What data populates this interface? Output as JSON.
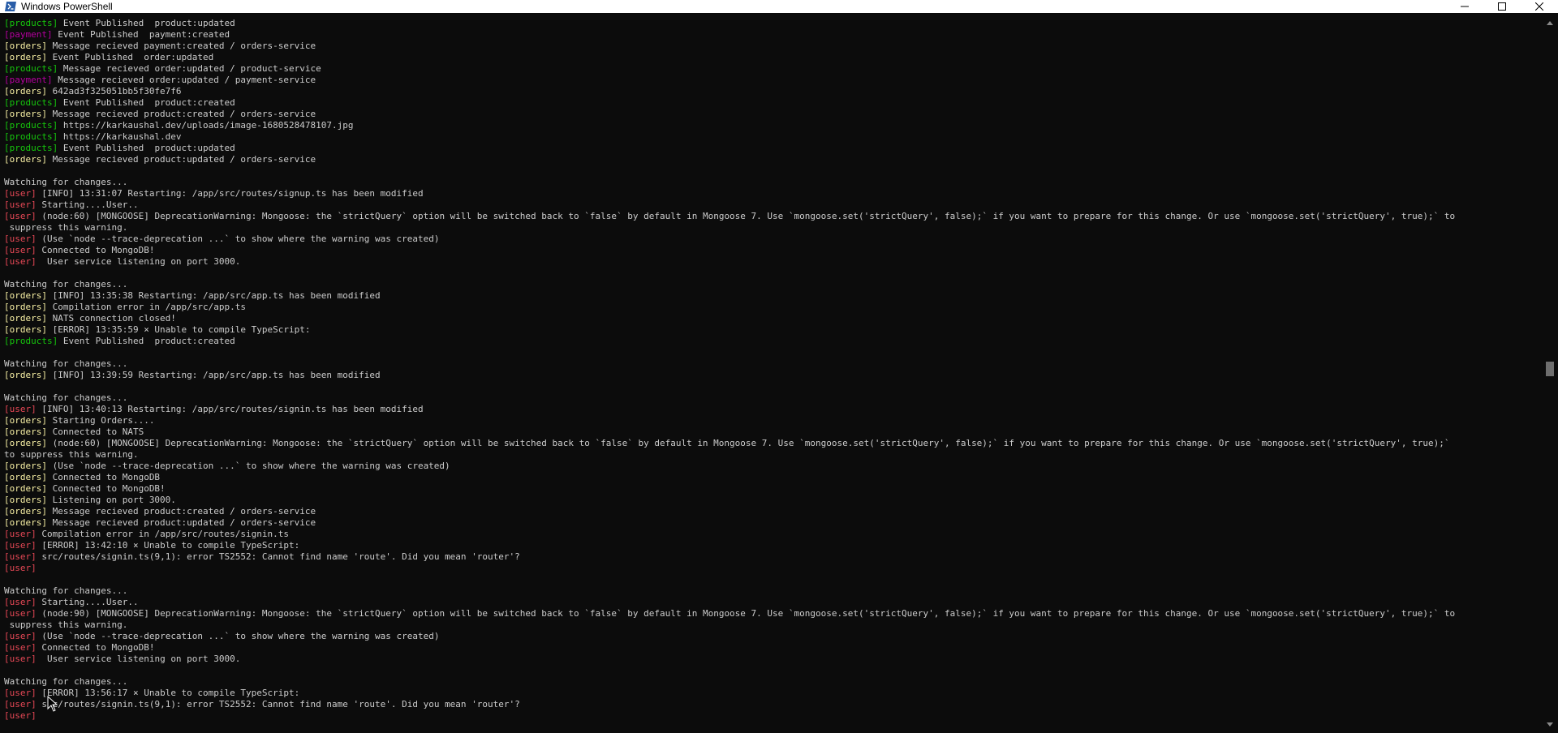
{
  "window": {
    "title": "Windows PowerShell",
    "icon": "powershell-icon",
    "controls": [
      "minimize-icon",
      "maximize-icon",
      "close-icon"
    ]
  },
  "colors": {
    "products": "#16c60c",
    "payment": "#b4009e",
    "orders": "#f9f1a5",
    "user": "#e74856",
    "text": "#cccccc",
    "background": "#0c0c0c"
  },
  "lines": [
    {
      "tag": "[products]",
      "service": "products",
      "text": " Event Published  product:updated"
    },
    {
      "tag": "[payment]",
      "service": "payment",
      "text": " Event Published  payment:created"
    },
    {
      "tag": "[orders]",
      "service": "orders",
      "text": " Message recieved payment:created / orders-service"
    },
    {
      "tag": "[orders]",
      "service": "orders",
      "text": " Event Published  order:updated"
    },
    {
      "tag": "[products]",
      "service": "products",
      "text": " Message recieved order:updated / product-service"
    },
    {
      "tag": "[payment]",
      "service": "payment",
      "text": " Message recieved order:updated / payment-service"
    },
    {
      "tag": "[orders]",
      "service": "orders",
      "text": " 642ad3f325051bb5f30fe7f6"
    },
    {
      "tag": "[products]",
      "service": "products",
      "text": " Event Published  product:created"
    },
    {
      "tag": "[orders]",
      "service": "orders",
      "text": " Message recieved product:created / orders-service"
    },
    {
      "tag": "[products]",
      "service": "products",
      "text": " https://karkaushal.dev/uploads/image-1680528478107.jpg"
    },
    {
      "tag": "[products]",
      "service": "products",
      "text": " https://karkaushal.dev"
    },
    {
      "tag": "[products]",
      "service": "products",
      "text": " Event Published  product:updated"
    },
    {
      "tag": "[orders]",
      "service": "orders",
      "text": " Message recieved product:updated / orders-service"
    },
    {
      "tag": "",
      "service": "sep",
      "text": ""
    },
    {
      "tag": "",
      "service": "plain",
      "text": "Watching for changes..."
    },
    {
      "tag": "[user]",
      "service": "user",
      "text": " [INFO] 13:31:07 Restarting: /app/src/routes/signup.ts has been modified"
    },
    {
      "tag": "[user]",
      "service": "user",
      "text": " Starting....User.."
    },
    {
      "tag": "[user]",
      "service": "user",
      "text": " (node:60) [MONGOOSE] DeprecationWarning: Mongoose: the `strictQuery` option will be switched back to `false` by default in Mongoose 7. Use `mongoose.set('strictQuery', false);` if you want to prepare for this change. Or use `mongoose.set('strictQuery', true);` to"
    },
    {
      "tag": "",
      "service": "plain",
      "text": " suppress this warning."
    },
    {
      "tag": "[user]",
      "service": "user",
      "text": " (Use `node --trace-deprecation ...` to show where the warning was created)"
    },
    {
      "tag": "[user]",
      "service": "user",
      "text": " Connected to MongoDB!"
    },
    {
      "tag": "[user]",
      "service": "user",
      "text": "  User service listening on port 3000."
    },
    {
      "tag": "",
      "service": "sep",
      "text": ""
    },
    {
      "tag": "",
      "service": "plain",
      "text": "Watching for changes..."
    },
    {
      "tag": "[orders]",
      "service": "orders",
      "text": " [INFO] 13:35:38 Restarting: /app/src/app.ts has been modified"
    },
    {
      "tag": "[orders]",
      "service": "orders",
      "text": " Compilation error in /app/src/app.ts"
    },
    {
      "tag": "[orders]",
      "service": "orders",
      "text": " NATS connection closed!"
    },
    {
      "tag": "[orders]",
      "service": "orders",
      "text": " [ERROR] 13:35:59 ⨯ Unable to compile TypeScript:"
    },
    {
      "tag": "[products]",
      "service": "products",
      "text": " Event Published  product:created"
    },
    {
      "tag": "",
      "service": "sep",
      "text": ""
    },
    {
      "tag": "",
      "service": "plain",
      "text": "Watching for changes..."
    },
    {
      "tag": "[orders]",
      "service": "orders",
      "text": " [INFO] 13:39:59 Restarting: /app/src/app.ts has been modified"
    },
    {
      "tag": "",
      "service": "sep",
      "text": ""
    },
    {
      "tag": "",
      "service": "plain",
      "text": "Watching for changes..."
    },
    {
      "tag": "[user]",
      "service": "user",
      "text": " [INFO] 13:40:13 Restarting: /app/src/routes/signin.ts has been modified"
    },
    {
      "tag": "[orders]",
      "service": "orders",
      "text": " Starting Orders...."
    },
    {
      "tag": "[orders]",
      "service": "orders",
      "text": " Connected to NATS"
    },
    {
      "tag": "[orders]",
      "service": "orders",
      "text": " (node:60) [MONGOOSE] DeprecationWarning: Mongoose: the `strictQuery` option will be switched back to `false` by default in Mongoose 7. Use `mongoose.set('strictQuery', false);` if you want to prepare for this change. Or use `mongoose.set('strictQuery', true);`"
    },
    {
      "tag": "",
      "service": "plain",
      "text": "to suppress this warning."
    },
    {
      "tag": "[orders]",
      "service": "orders",
      "text": " (Use `node --trace-deprecation ...` to show where the warning was created)"
    },
    {
      "tag": "[orders]",
      "service": "orders",
      "text": " Connected to MongoDB"
    },
    {
      "tag": "[orders]",
      "service": "orders",
      "text": " Connected to MongoDB!"
    },
    {
      "tag": "[orders]",
      "service": "orders",
      "text": " Listening on port 3000."
    },
    {
      "tag": "[orders]",
      "service": "orders",
      "text": " Message recieved product:created / orders-service"
    },
    {
      "tag": "[orders]",
      "service": "orders",
      "text": " Message recieved product:updated / orders-service"
    },
    {
      "tag": "[user]",
      "service": "user",
      "text": " Compilation error in /app/src/routes/signin.ts"
    },
    {
      "tag": "[user]",
      "service": "user",
      "text": " [ERROR] 13:42:10 ⨯ Unable to compile TypeScript:"
    },
    {
      "tag": "[user]",
      "service": "user",
      "text": " src/routes/signin.ts(9,1): error TS2552: Cannot find name 'route'. Did you mean 'router'?"
    },
    {
      "tag": "[user]",
      "service": "user",
      "text": ""
    },
    {
      "tag": "",
      "service": "sep",
      "text": ""
    },
    {
      "tag": "",
      "service": "plain",
      "text": "Watching for changes..."
    },
    {
      "tag": "[user]",
      "service": "user",
      "text": " Starting....User.."
    },
    {
      "tag": "[user]",
      "service": "user",
      "text": " (node:90) [MONGOOSE] DeprecationWarning: Mongoose: the `strictQuery` option will be switched back to `false` by default in Mongoose 7. Use `mongoose.set('strictQuery', false);` if you want to prepare for this change. Or use `mongoose.set('strictQuery', true);` to"
    },
    {
      "tag": "",
      "service": "plain",
      "text": " suppress this warning."
    },
    {
      "tag": "[user]",
      "service": "user",
      "text": " (Use `node --trace-deprecation ...` to show where the warning was created)"
    },
    {
      "tag": "[user]",
      "service": "user",
      "text": " Connected to MongoDB!"
    },
    {
      "tag": "[user]",
      "service": "user",
      "text": "  User service listening on port 3000."
    },
    {
      "tag": "",
      "service": "sep",
      "text": ""
    },
    {
      "tag": "",
      "service": "plain",
      "text": "Watching for changes..."
    },
    {
      "tag": "[user]",
      "service": "user",
      "text": " [ERROR] 13:56:17 ⨯ Unable to compile TypeScript:"
    },
    {
      "tag": "[user]",
      "service": "user",
      "text": " src/routes/signin.ts(9,1): error TS2552: Cannot find name 'route'. Did you mean 'router'?"
    },
    {
      "tag": "[user]",
      "service": "user",
      "text": ""
    }
  ]
}
